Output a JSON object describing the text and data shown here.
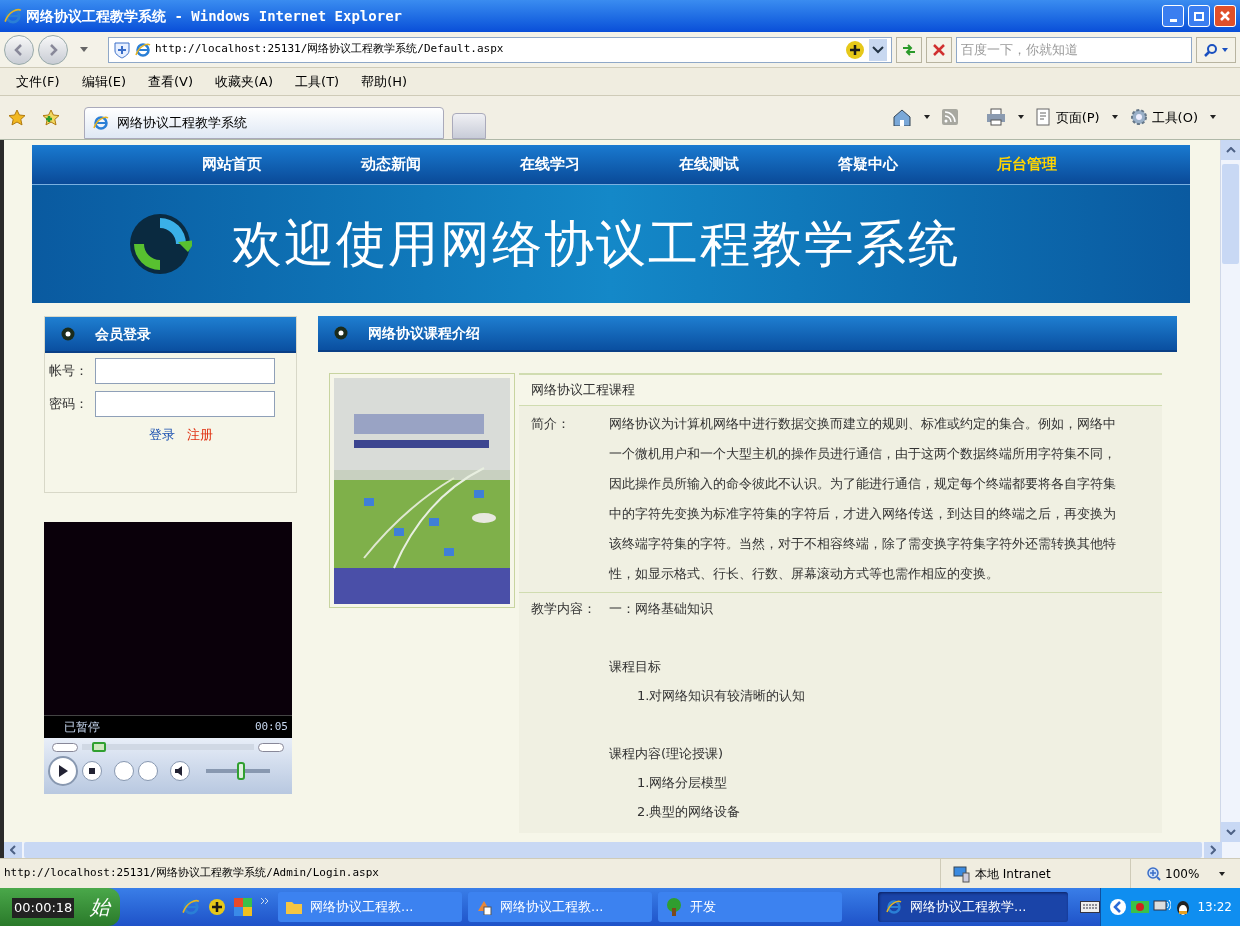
{
  "window": {
    "title": "网络协议工程教学系统 - Windows Internet Explorer"
  },
  "address_bar": {
    "url": "http://localhost:25131/网络协议工程教学系统/Default.aspx",
    "search_placeholder": "百度一下，你就知道"
  },
  "menu": [
    "文件(F)",
    "编辑(E)",
    "查看(V)",
    "收藏夹(A)",
    "工具(T)",
    "帮助(H)"
  ],
  "tab": {
    "title": "网络协议工程教学系统"
  },
  "command_bar": [
    "页面(P)",
    "工具(O)"
  ],
  "page": {
    "nav": [
      {
        "label": "网站首页",
        "selected": false
      },
      {
        "label": "动态新闻",
        "selected": false
      },
      {
        "label": "在线学习",
        "selected": false
      },
      {
        "label": "在线测试",
        "selected": false
      },
      {
        "label": "答疑中心",
        "selected": false
      },
      {
        "label": "后台管理",
        "selected": true
      }
    ],
    "banner_title": "欢迎使用网络协议工程教学系统",
    "login": {
      "title": "会员登录",
      "account_label": "帐号：",
      "password_label": "密码：",
      "login_link": "登录",
      "register_link": "注册"
    },
    "player": {
      "status": "已暂停",
      "time": "00:05",
      "seek": {
        "level": 0.1
      },
      "volume": {
        "level": 0.55
      }
    },
    "course": {
      "title": "网络协议课程介绍",
      "name": "网络协议工程课程",
      "intro_label": "简介：",
      "intro": "网络协议为计算机网络中进行数据交换而建立的规则、标准或约定的集合。例如，网络中一个微机用户和一个大型主机的操作员进行通信，由于这两个数据终端所用字符集不同，因此操作员所输入的命令彼此不认识。为了能进行通信，规定每个终端都要将各自字符集中的字符先变换为标准字符集的字符后，才进入网络传送，到达目的终端之后，再变换为该终端字符集的字符。当然，对于不相容终端，除了需变换字符集字符外还需转换其他特性，如显示格式、行长、行数、屏幕滚动方式等也需作相应的变换。",
      "content_label": "教学内容：",
      "content": [
        {
          "kind": "heading",
          "text": "一：网络基础知识"
        },
        {
          "kind": "gap"
        },
        {
          "kind": "heading",
          "text": "课程目标"
        },
        {
          "kind": "item",
          "text": "1.对网络知识有较清晰的认知"
        },
        {
          "kind": "gap"
        },
        {
          "kind": "heading",
          "text": "课程内容(理论授课)"
        },
        {
          "kind": "item",
          "text": "1.网络分层模型"
        },
        {
          "kind": "item",
          "text": "2.典型的网络设备"
        }
      ]
    }
  },
  "status_bar": {
    "url": "http://localhost:25131/网络协议工程教学系统/Admin/Login.aspx",
    "zone": "本地 Intranet",
    "zoom": "100%"
  },
  "taskbar": {
    "start": "始",
    "timer": "00:00:18",
    "items": [
      {
        "label": "网络协议工程教...",
        "selected": false,
        "kind": "folder"
      },
      {
        "label": "网络协议工程教...",
        "selected": false,
        "kind": "app"
      },
      {
        "label": "开发",
        "selected": false,
        "kind": "tree"
      },
      {
        "label": "网络协议工程教学...",
        "selected": true,
        "kind": "browser"
      }
    ],
    "clock": "13:22"
  }
}
